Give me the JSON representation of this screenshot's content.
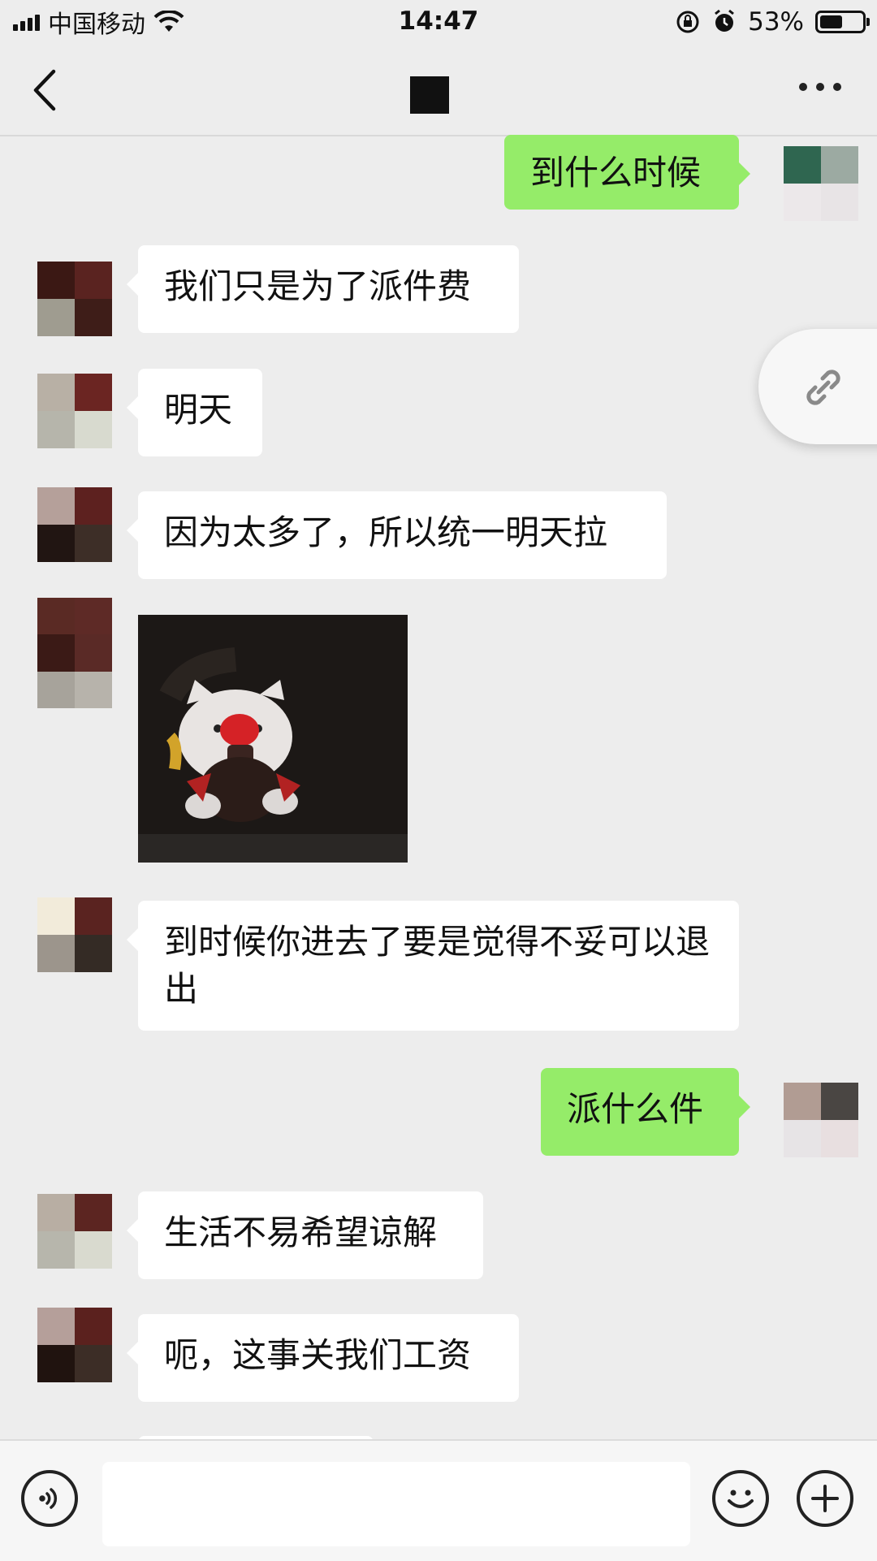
{
  "status_bar": {
    "carrier": "中国移动",
    "time": "14:47",
    "battery_percent_text": "53%",
    "battery_level": 0.53
  },
  "nav": {
    "back_icon": "chevron-left-icon",
    "more_icon": "more-horizontal-icon"
  },
  "messages": [
    {
      "side": "right",
      "type": "text",
      "text": "到什么时候"
    },
    {
      "side": "left",
      "type": "text",
      "text": "我们只是为了派件费"
    },
    {
      "side": "left",
      "type": "text",
      "text": "明天"
    },
    {
      "side": "left",
      "type": "text",
      "text": "因为太多了，所以统一明天拉"
    },
    {
      "side": "left",
      "type": "image",
      "alt": "cat sticker"
    },
    {
      "side": "left",
      "type": "text",
      "text": "到时候你进去了要是觉得不妥可以退出"
    },
    {
      "side": "right",
      "type": "text",
      "text": "派什么件"
    },
    {
      "side": "left",
      "type": "text",
      "text": "生活不易希望谅解"
    },
    {
      "side": "left",
      "type": "text",
      "text": "呃，这事关我们工资"
    }
  ],
  "floating_button": {
    "icon": "link-icon"
  },
  "input_bar": {
    "voice_icon": "voice-icon",
    "emoji_icon": "emoji-icon",
    "plus_icon": "plus-icon",
    "input_value": ""
  },
  "colors": {
    "background": "#ededed",
    "bubble_sent": "#95ec69",
    "bubble_received": "#ffffff"
  }
}
